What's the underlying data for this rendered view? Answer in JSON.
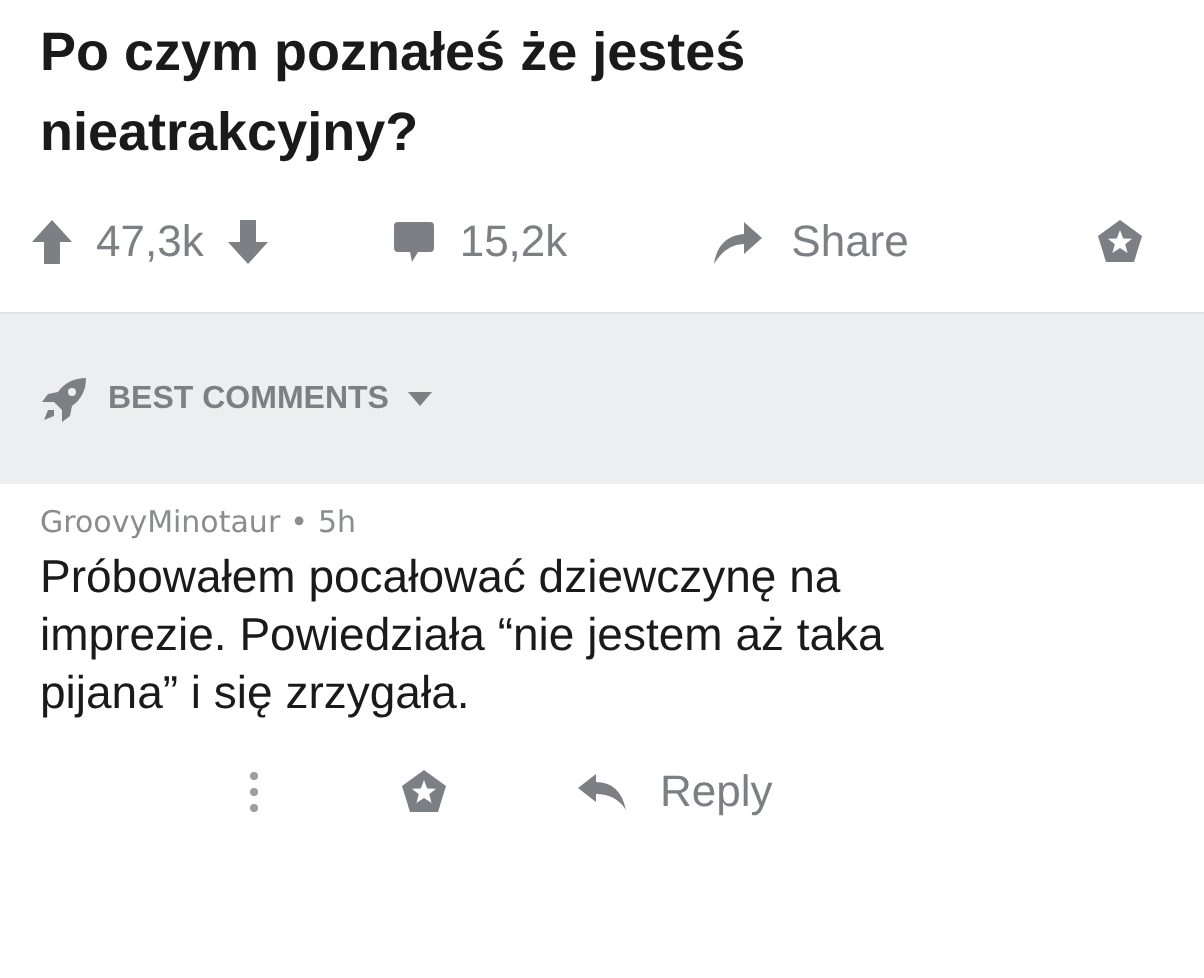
{
  "post": {
    "title": "Po czym poznałeś że jesteś nieatrakcyjny?"
  },
  "actions": {
    "score": "47,3k",
    "comments": "15,2k",
    "share": "Share"
  },
  "sort": {
    "label": "BEST COMMENTS"
  },
  "comment": {
    "author": "GroovyMinotaur",
    "separator": "•",
    "age": "5h",
    "body": "Próbowałem pocałować dziewczynę na imprezie. Powiedziała “nie jestem aż taka pijana” i się zrzygała.",
    "reply": "Reply"
  }
}
